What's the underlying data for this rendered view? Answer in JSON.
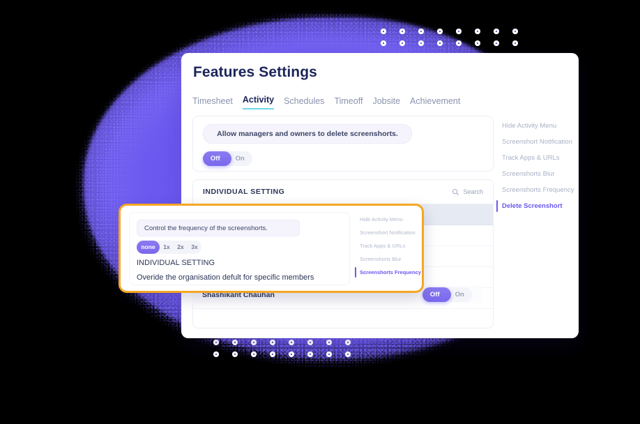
{
  "window": {
    "title": "Features Settings"
  },
  "tabs": [
    {
      "label": "Timesheet",
      "active": false
    },
    {
      "label": "Activity",
      "active": true
    },
    {
      "label": "Schedules",
      "active": false
    },
    {
      "label": "Timeoff",
      "active": false
    },
    {
      "label": "Jobsite",
      "active": false
    },
    {
      "label": "Achievement",
      "active": false
    }
  ],
  "delete_screenshot_panel": {
    "description": "Allow managers and owners to delete screenshorts.",
    "toggle": {
      "off_label": "Off",
      "on_label": "On",
      "selected": "Off"
    }
  },
  "individual_setting": {
    "title": "INDIVIDUAL SETTING",
    "search_label": "Search",
    "search_icon": "search-icon",
    "rows": [
      {
        "name": ""
      },
      {
        "name": ""
      },
      {
        "name": ""
      },
      {
        "name": ""
      },
      {
        "name": "Shashikant Chauhan",
        "toggle": {
          "off_label": "Off",
          "on_label": "On",
          "selected": "Off"
        }
      }
    ]
  },
  "right_menu": {
    "items": [
      {
        "label": "Hide Activity Menu",
        "active": false
      },
      {
        "label": "Screenshort Notification",
        "active": false
      },
      {
        "label": "Track Apps & URLs",
        "active": false
      },
      {
        "label": "Screenshorts Blur",
        "active": false
      },
      {
        "label": "Screenshorts Frequency",
        "active": false
      },
      {
        "label": "Delete Screenshort",
        "active": true
      }
    ]
  },
  "callout": {
    "description": "Control the frequency of the screenshorts.",
    "frequency": {
      "options": [
        "none",
        "1x",
        "2x",
        "3x"
      ],
      "selected": "none"
    },
    "section_title": "INDIVIDUAL SETTING",
    "section_subtitle": "Overide the organisation defult for specific members",
    "menu": [
      {
        "label": "Hide Activity Menu",
        "active": false
      },
      {
        "label": "Screenshort Notification",
        "active": false
      },
      {
        "label": "Track Apps & URLs",
        "active": false
      },
      {
        "label": "Screenshorts Blur",
        "active": false
      },
      {
        "label": "Screenshorts Frequency",
        "active": true
      }
    ]
  },
  "colors": {
    "accent_purple": "#6a58ef",
    "highlight_orange": "#f5a623",
    "tab_underline": "#6fd8e8",
    "text_dark": "#1b2559",
    "text_muted": "#8a93ad"
  }
}
